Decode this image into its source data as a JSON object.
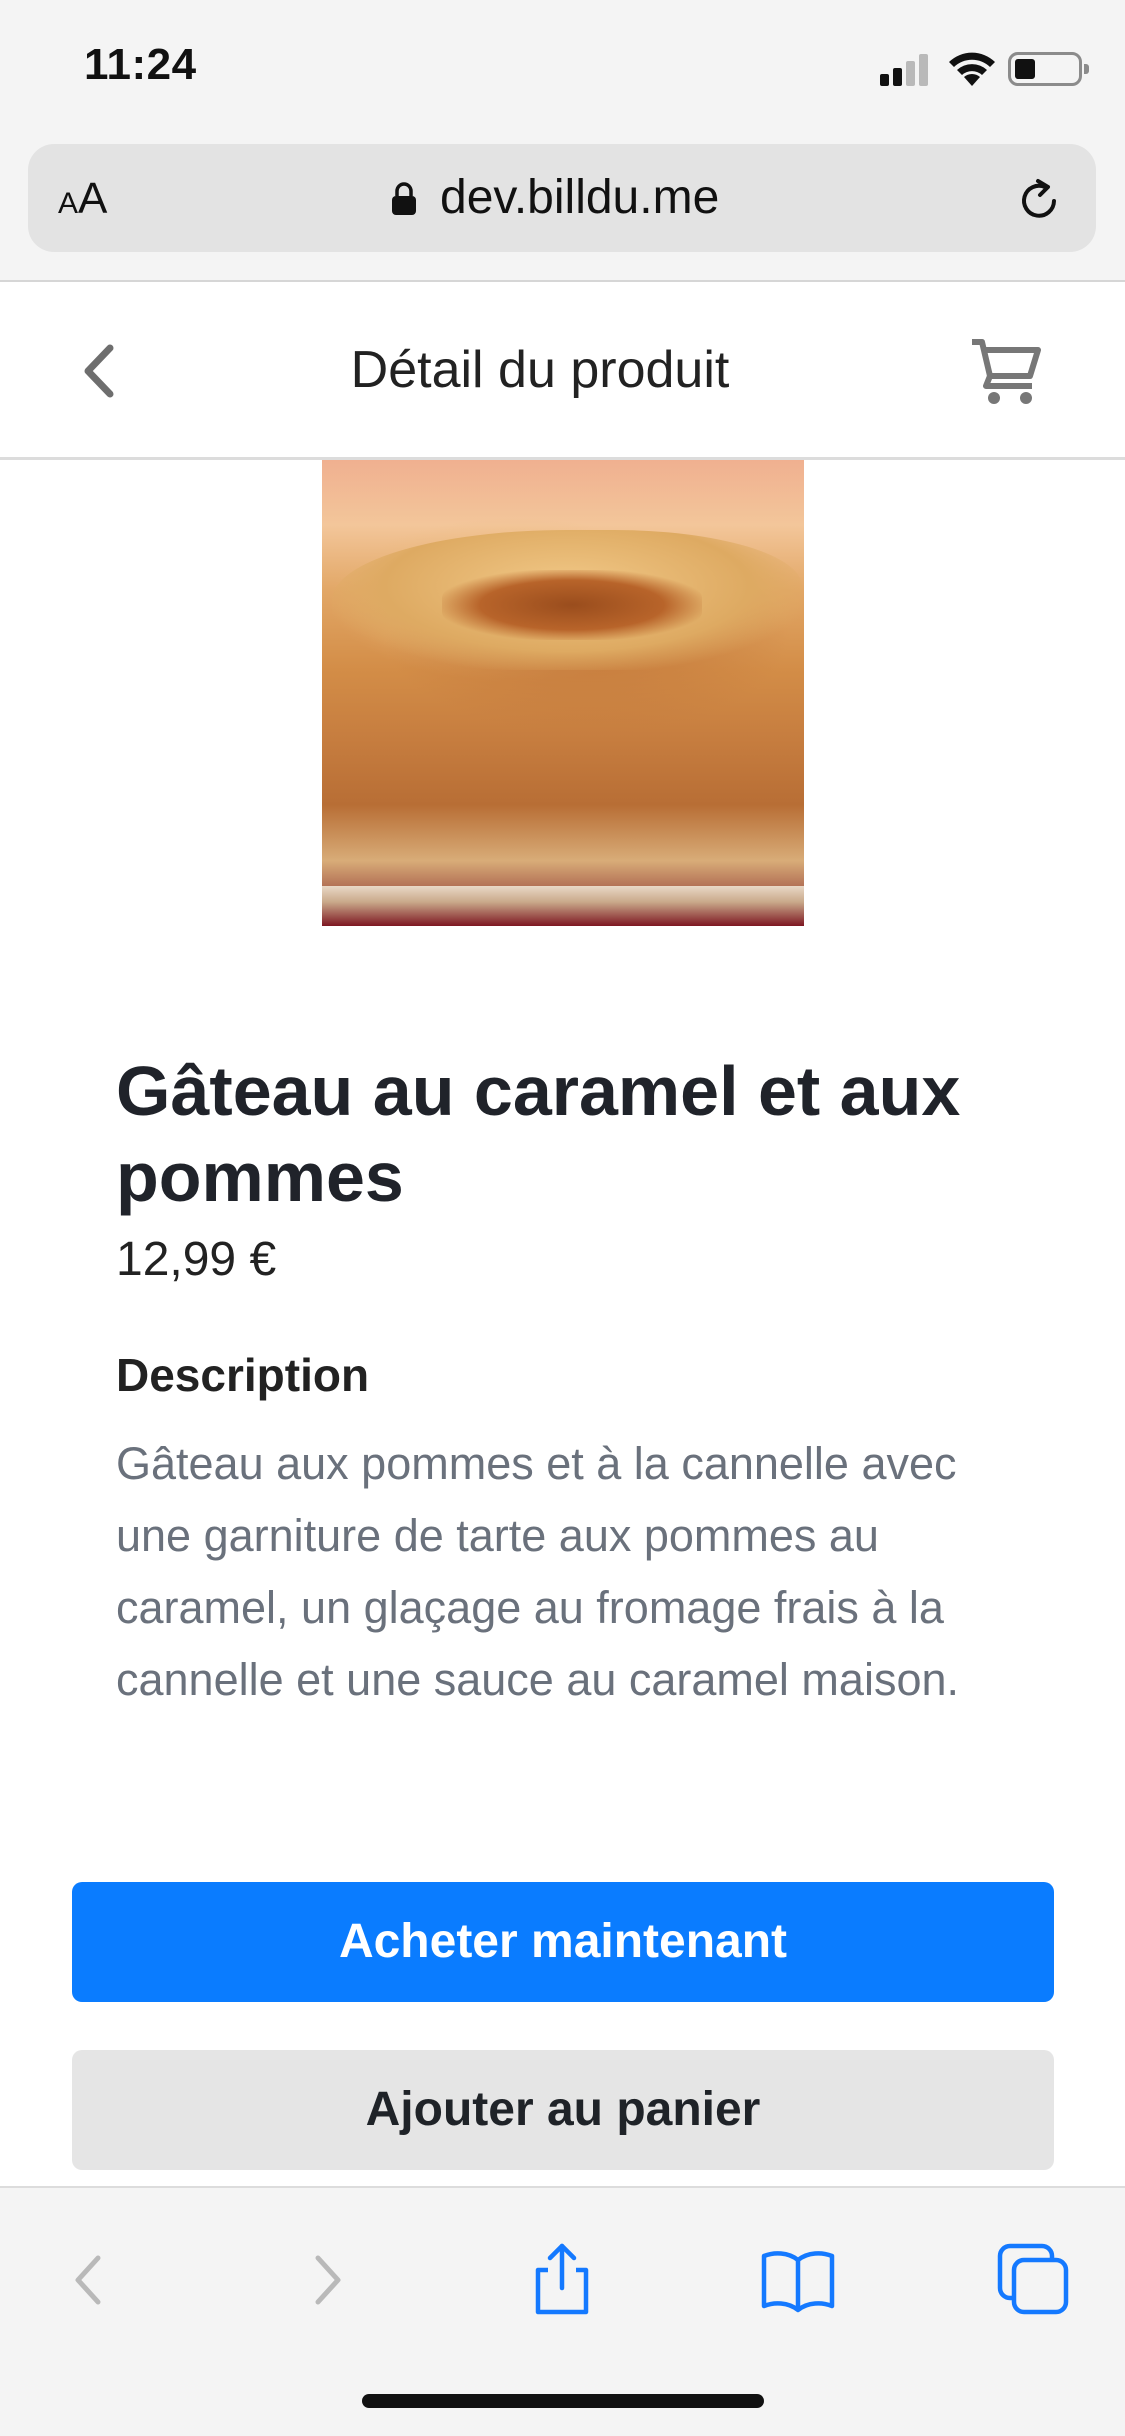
{
  "status_bar": {
    "time": "11:24"
  },
  "browser": {
    "text_size_label": "AA",
    "url": "dev.billdu.me"
  },
  "header": {
    "title": "Détail du produit",
    "icons": {
      "back": "chevron-left-icon",
      "cart": "cart-icon"
    }
  },
  "product": {
    "image_alt": "Gâteau au caramel et aux pommes",
    "name": "Gâteau au caramel et aux pommes",
    "price": "12,99 €",
    "description_label": "Description",
    "description": "Gâteau aux pommes et à la cannelle avec une garniture de tarte aux pommes au caramel, un glaçage au fromage frais à la cannelle et une sauce au caramel maison."
  },
  "actions": {
    "buy_now": "Acheter maintenant",
    "add_to_cart": "Ajouter au panier"
  },
  "toolbar": {
    "icons": [
      "back-icon",
      "forward-icon",
      "share-icon",
      "bookmarks-icon",
      "tabs-icon"
    ]
  },
  "colors": {
    "primary": "#0a7cff",
    "secondary_button": "#e5e5e5",
    "muted_text": "#6a717c",
    "safari_blue": "#1479ff",
    "disabled_gray": "#b9b9b9"
  }
}
